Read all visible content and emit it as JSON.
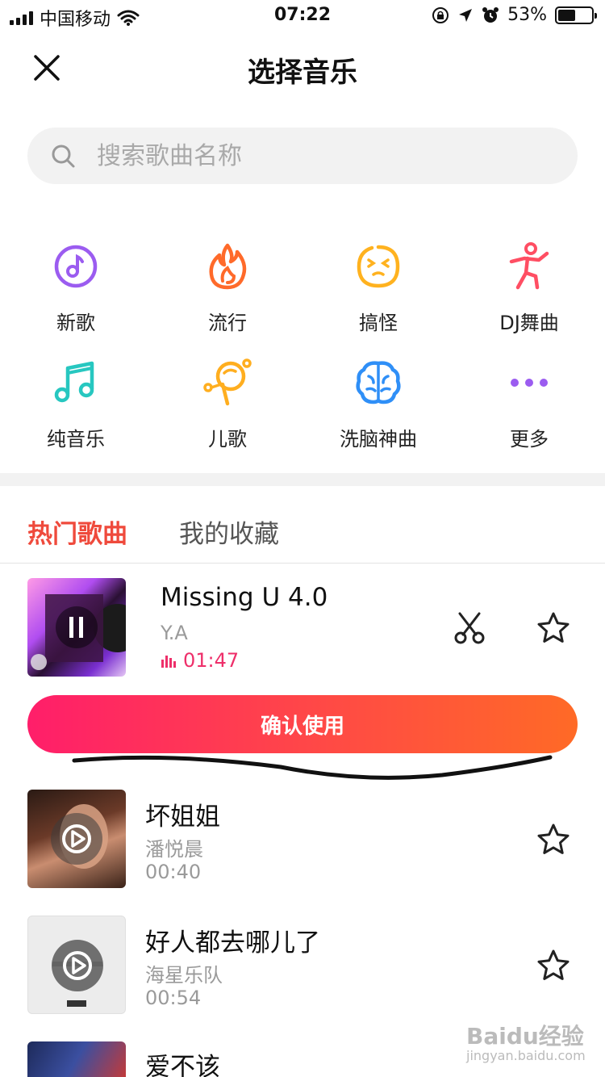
{
  "status_bar": {
    "carrier": "中国移动",
    "time": "07:22",
    "battery_percent": "53%",
    "battery_level": 0.53
  },
  "header": {
    "title": "选择音乐",
    "close_icon": "close-icon"
  },
  "search": {
    "placeholder": "搜索歌曲名称",
    "value": ""
  },
  "categories": [
    {
      "label": "新歌",
      "icon": "music-disc-icon",
      "color": "#9b5cf0"
    },
    {
      "label": "流行",
      "icon": "flame-icon",
      "color": "#ff6a2a"
    },
    {
      "label": "搞怪",
      "icon": "funny-face-icon",
      "color": "#ffb21f"
    },
    {
      "label": "DJ舞曲",
      "icon": "dancer-icon",
      "color": "#ff4e63"
    },
    {
      "label": "纯音乐",
      "icon": "music-note-icon",
      "color": "#27c7c0"
    },
    {
      "label": "儿歌",
      "icon": "lollipop-icon",
      "color": "#ffae1f"
    },
    {
      "label": "洗脑神曲",
      "icon": "brain-icon",
      "color": "#2f8ff7"
    },
    {
      "label": "更多",
      "icon": "more-dots-icon",
      "color": "#9b5cf0"
    }
  ],
  "tabs": {
    "hot": "热门歌曲",
    "favorites": "我的收藏"
  },
  "songs": [
    {
      "title": "Missing U 4.0",
      "artist": "Y.A",
      "duration": "01:47",
      "state": "playing"
    },
    {
      "title": "坏姐姐",
      "artist": "潘悦晨",
      "duration": "00:40",
      "state": "paused"
    },
    {
      "title": "好人都去哪儿了",
      "artist": "海星乐队",
      "duration": "00:54",
      "state": "paused"
    },
    {
      "title": "爱不该",
      "artist": "",
      "duration": "",
      "state": "paused"
    }
  ],
  "confirm_button": {
    "label": "确认使用"
  },
  "watermark": {
    "text": "Baidu经验",
    "sub": "jingyan.baidu.com"
  },
  "colors": {
    "accent": "#ef4a3c",
    "playing_time": "#ee2f6a",
    "button_gradient_start": "#ff1e6a",
    "button_gradient_end": "#ff6a26"
  }
}
